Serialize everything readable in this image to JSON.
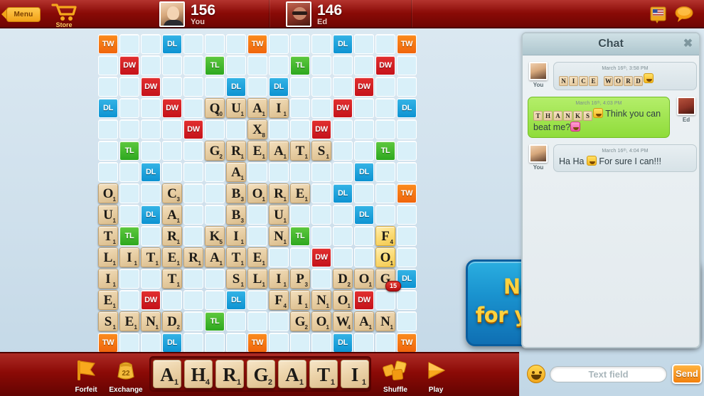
{
  "topbar": {
    "menu_label": "Menu",
    "store_label": "Store",
    "divider": "",
    "players": [
      {
        "name": "You",
        "score": "156"
      },
      {
        "name": "Ed",
        "score": "146"
      }
    ],
    "dictionary_icon": "dictionary-us-icon",
    "chat_icon": "chat-bubble-icon"
  },
  "board": {
    "premium_labels": {
      "tw": "TW",
      "dw": "DW",
      "tl": "TL",
      "dl": "DL"
    },
    "size": 15,
    "premiums": [
      {
        "r": 0,
        "c": 0,
        "t": "tw"
      },
      {
        "r": 0,
        "c": 3,
        "t": "dl"
      },
      {
        "r": 0,
        "c": 7,
        "t": "tw"
      },
      {
        "r": 0,
        "c": 11,
        "t": "dl"
      },
      {
        "r": 0,
        "c": 14,
        "t": "tw"
      },
      {
        "r": 1,
        "c": 1,
        "t": "dw"
      },
      {
        "r": 1,
        "c": 5,
        "t": "tl"
      },
      {
        "r": 1,
        "c": 9,
        "t": "tl"
      },
      {
        "r": 1,
        "c": 13,
        "t": "dw"
      },
      {
        "r": 2,
        "c": 2,
        "t": "dw"
      },
      {
        "r": 2,
        "c": 6,
        "t": "dl"
      },
      {
        "r": 2,
        "c": 8,
        "t": "dl"
      },
      {
        "r": 2,
        "c": 12,
        "t": "dw"
      },
      {
        "r": 3,
        "c": 0,
        "t": "dl"
      },
      {
        "r": 3,
        "c": 3,
        "t": "dw"
      },
      {
        "r": 3,
        "c": 11,
        "t": "dw"
      },
      {
        "r": 3,
        "c": 14,
        "t": "dl"
      },
      {
        "r": 4,
        "c": 4,
        "t": "dw"
      },
      {
        "r": 4,
        "c": 10,
        "t": "dw"
      },
      {
        "r": 5,
        "c": 1,
        "t": "tl"
      },
      {
        "r": 5,
        "c": 13,
        "t": "tl"
      },
      {
        "r": 6,
        "c": 2,
        "t": "dl"
      },
      {
        "r": 6,
        "c": 12,
        "t": "dl"
      },
      {
        "r": 7,
        "c": 0,
        "t": "tw"
      },
      {
        "r": 7,
        "c": 11,
        "t": "dl"
      },
      {
        "r": 7,
        "c": 14,
        "t": "tw"
      },
      {
        "r": 8,
        "c": 2,
        "t": "dl"
      },
      {
        "r": 8,
        "c": 12,
        "t": "dl"
      },
      {
        "r": 9,
        "c": 1,
        "t": "tl"
      },
      {
        "r": 9,
        "c": 9,
        "t": "tl"
      },
      {
        "r": 10,
        "c": 4,
        "t": "dw"
      },
      {
        "r": 10,
        "c": 10,
        "t": "dw"
      },
      {
        "r": 11,
        "c": 3,
        "t": "dw"
      },
      {
        "r": 11,
        "c": 11,
        "t": "dw"
      },
      {
        "r": 11,
        "c": 14,
        "t": "dl"
      },
      {
        "r": 12,
        "c": 2,
        "t": "dw"
      },
      {
        "r": 12,
        "c": 6,
        "t": "dl"
      },
      {
        "r": 12,
        "c": 12,
        "t": "dw"
      },
      {
        "r": 13,
        "c": 1,
        "t": "tl"
      },
      {
        "r": 13,
        "c": 5,
        "t": "tl"
      },
      {
        "r": 13,
        "c": 9,
        "t": "tl"
      },
      {
        "r": 13,
        "c": 13,
        "t": "tl"
      },
      {
        "r": 14,
        "c": 0,
        "t": "tw"
      },
      {
        "r": 14,
        "c": 3,
        "t": "dl"
      },
      {
        "r": 14,
        "c": 7,
        "t": "tw"
      },
      {
        "r": 14,
        "c": 11,
        "t": "dl"
      },
      {
        "r": 14,
        "c": 14,
        "t": "tw"
      }
    ],
    "tiles": [
      {
        "r": 3,
        "c": 5,
        "l": "Q",
        "v": "10"
      },
      {
        "r": 3,
        "c": 6,
        "l": "U",
        "v": "1"
      },
      {
        "r": 3,
        "c": 7,
        "l": "A",
        "v": "1"
      },
      {
        "r": 3,
        "c": 8,
        "l": "I",
        "v": "1"
      },
      {
        "r": 4,
        "c": 7,
        "l": "X",
        "v": "8"
      },
      {
        "r": 5,
        "c": 5,
        "l": "G",
        "v": "2"
      },
      {
        "r": 5,
        "c": 6,
        "l": "R",
        "v": "1"
      },
      {
        "r": 5,
        "c": 7,
        "l": "E",
        "v": "1"
      },
      {
        "r": 5,
        "c": 8,
        "l": "A",
        "v": "1"
      },
      {
        "r": 5,
        "c": 9,
        "l": "T",
        "v": "1"
      },
      {
        "r": 5,
        "c": 10,
        "l": "S",
        "v": "1"
      },
      {
        "r": 6,
        "c": 6,
        "l": "A",
        "v": "1"
      },
      {
        "r": 7,
        "c": 0,
        "l": "O",
        "v": "1"
      },
      {
        "r": 7,
        "c": 3,
        "l": "C",
        "v": "3"
      },
      {
        "r": 7,
        "c": 6,
        "l": "B",
        "v": "3"
      },
      {
        "r": 7,
        "c": 7,
        "l": "O",
        "v": "1"
      },
      {
        "r": 7,
        "c": 8,
        "l": "R",
        "v": "1"
      },
      {
        "r": 7,
        "c": 9,
        "l": "E",
        "v": "1"
      },
      {
        "r": 8,
        "c": 0,
        "l": "U",
        "v": "1"
      },
      {
        "r": 8,
        "c": 3,
        "l": "A",
        "v": "1"
      },
      {
        "r": 8,
        "c": 6,
        "l": "B",
        "v": "3"
      },
      {
        "r": 8,
        "c": 8,
        "l": "U",
        "v": "1"
      },
      {
        "r": 9,
        "c": 0,
        "l": "T",
        "v": "1"
      },
      {
        "r": 9,
        "c": 3,
        "l": "R",
        "v": "1"
      },
      {
        "r": 9,
        "c": 5,
        "l": "K",
        "v": "5"
      },
      {
        "r": 9,
        "c": 6,
        "l": "I",
        "v": "1"
      },
      {
        "r": 9,
        "c": 8,
        "l": "N",
        "v": "1"
      },
      {
        "r": 9,
        "c": 13,
        "l": "F",
        "v": "4",
        "new": true
      },
      {
        "r": 10,
        "c": 0,
        "l": "L",
        "v": "1"
      },
      {
        "r": 10,
        "c": 1,
        "l": "I",
        "v": "1"
      },
      {
        "r": 10,
        "c": 2,
        "l": "T",
        "v": "1"
      },
      {
        "r": 10,
        "c": 3,
        "l": "E",
        "v": "1"
      },
      {
        "r": 10,
        "c": 4,
        "l": "R",
        "v": "1"
      },
      {
        "r": 10,
        "c": 5,
        "l": "A",
        "v": "1"
      },
      {
        "r": 10,
        "c": 6,
        "l": "T",
        "v": "1"
      },
      {
        "r": 10,
        "c": 7,
        "l": "E",
        "v": "1"
      },
      {
        "r": 10,
        "c": 13,
        "l": "O",
        "v": "1",
        "new": true
      },
      {
        "r": 11,
        "c": 0,
        "l": "I",
        "v": "1"
      },
      {
        "r": 11,
        "c": 3,
        "l": "T",
        "v": "1"
      },
      {
        "r": 11,
        "c": 6,
        "l": "S",
        "v": "1"
      },
      {
        "r": 11,
        "c": 7,
        "l": "L",
        "v": "1"
      },
      {
        "r": 11,
        "c": 8,
        "l": "I",
        "v": "1"
      },
      {
        "r": 11,
        "c": 9,
        "l": "P",
        "v": "3"
      },
      {
        "r": 11,
        "c": 11,
        "l": "D",
        "v": "2"
      },
      {
        "r": 11,
        "c": 12,
        "l": "O",
        "v": "1"
      },
      {
        "r": 11,
        "c": 13,
        "l": "G",
        "v": "2"
      },
      {
        "r": 12,
        "c": 0,
        "l": "E",
        "v": "1"
      },
      {
        "r": 12,
        "c": 8,
        "l": "F",
        "v": "4"
      },
      {
        "r": 12,
        "c": 9,
        "l": "I",
        "v": "1"
      },
      {
        "r": 12,
        "c": 10,
        "l": "N",
        "v": "1"
      },
      {
        "r": 12,
        "c": 11,
        "l": "O",
        "v": "1"
      },
      {
        "r": 13,
        "c": 0,
        "l": "S",
        "v": "1"
      },
      {
        "r": 13,
        "c": 1,
        "l": "E",
        "v": "1"
      },
      {
        "r": 13,
        "c": 2,
        "l": "N",
        "v": "1"
      },
      {
        "r": 13,
        "c": 3,
        "l": "D",
        "v": "2"
      },
      {
        "r": 13,
        "c": 9,
        "l": "G",
        "v": "2"
      },
      {
        "r": 13,
        "c": 10,
        "l": "O",
        "v": "1"
      },
      {
        "r": 13,
        "c": 11,
        "l": "W",
        "v": "4"
      },
      {
        "r": 13,
        "c": 12,
        "l": "A",
        "v": "1"
      },
      {
        "r": 13,
        "c": 13,
        "l": "N",
        "v": "1"
      }
    ],
    "move_score": {
      "value": "15",
      "r": 11,
      "c": 13
    }
  },
  "bottombar": {
    "forfeit_label": "Forfeit",
    "exchange_label": "Exchange",
    "exchange_count": "22",
    "shuffle_label": "Shuffle",
    "play_label": "Play",
    "rack": [
      {
        "l": "A",
        "v": "1"
      },
      {
        "l": "H",
        "v": "4"
      },
      {
        "l": "R",
        "v": "1"
      },
      {
        "l": "G",
        "v": "2"
      },
      {
        "l": "A",
        "v": "1"
      },
      {
        "l": "T",
        "v": "1"
      },
      {
        "l": "I",
        "v": "1"
      }
    ]
  },
  "chat": {
    "title": "Chat",
    "close_icon": "✖",
    "messages": [
      {
        "author": "You",
        "side": "left",
        "timestamp": "March 16ᵗʰ, 3:58 PM",
        "tiles": [
          "N",
          "I",
          "C",
          "E",
          "",
          "W",
          "O",
          "R",
          "D"
        ],
        "emoji_after_tiles": true,
        "text": ""
      },
      {
        "author": "Ed",
        "side": "right",
        "timestamp": "March 16ᵗʰ, 4:03 PM",
        "tiles": [
          "T",
          "H",
          "A",
          "N",
          "K",
          "S"
        ],
        "emoji_after_tiles": true,
        "text": "Think you can beat me?"
      },
      {
        "author": "You",
        "side": "left",
        "timestamp": "March 16ᵗʰ, 4:04 PM",
        "tiles": [],
        "emoji_after_tiles": false,
        "text_before": "Ha Ha",
        "text": "For sure I can!!!"
      }
    ],
    "input_placeholder": "Text field",
    "send_label": "Send",
    "emoji_button": "smiley-icon"
  },
  "promo": {
    "line1": "Now Available",
    "line2": "for your HD Tablet!"
  },
  "colors": {
    "tw": "#f0650c",
    "dw": "#c5121a",
    "tl": "#2da81f",
    "dl": "#0d93d2",
    "bar_red": "#8b0a06",
    "tile": "#e8cfa5",
    "new_tile": "#fbdc78",
    "promo_blue": "#1a93cf",
    "promo_yellow": "#ffd23f"
  }
}
